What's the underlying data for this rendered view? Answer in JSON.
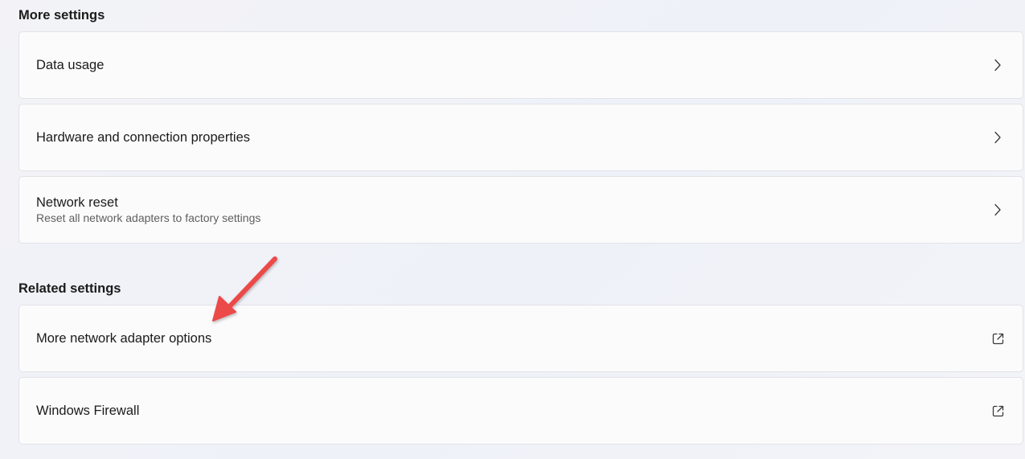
{
  "more_settings": {
    "title": "More settings",
    "items": [
      {
        "title": "Data usage",
        "icon": "chevron-right-icon"
      },
      {
        "title": "Hardware and connection properties",
        "icon": "chevron-right-icon"
      },
      {
        "title": "Network reset",
        "subtitle": "Reset all network adapters to factory settings",
        "icon": "chevron-right-icon"
      }
    ]
  },
  "related_settings": {
    "title": "Related settings",
    "items": [
      {
        "title": "More network adapter options",
        "icon": "external-link-icon"
      },
      {
        "title": "Windows Firewall",
        "icon": "external-link-icon"
      }
    ]
  },
  "annotation": {
    "arrow_color": "#ec4a4a"
  }
}
